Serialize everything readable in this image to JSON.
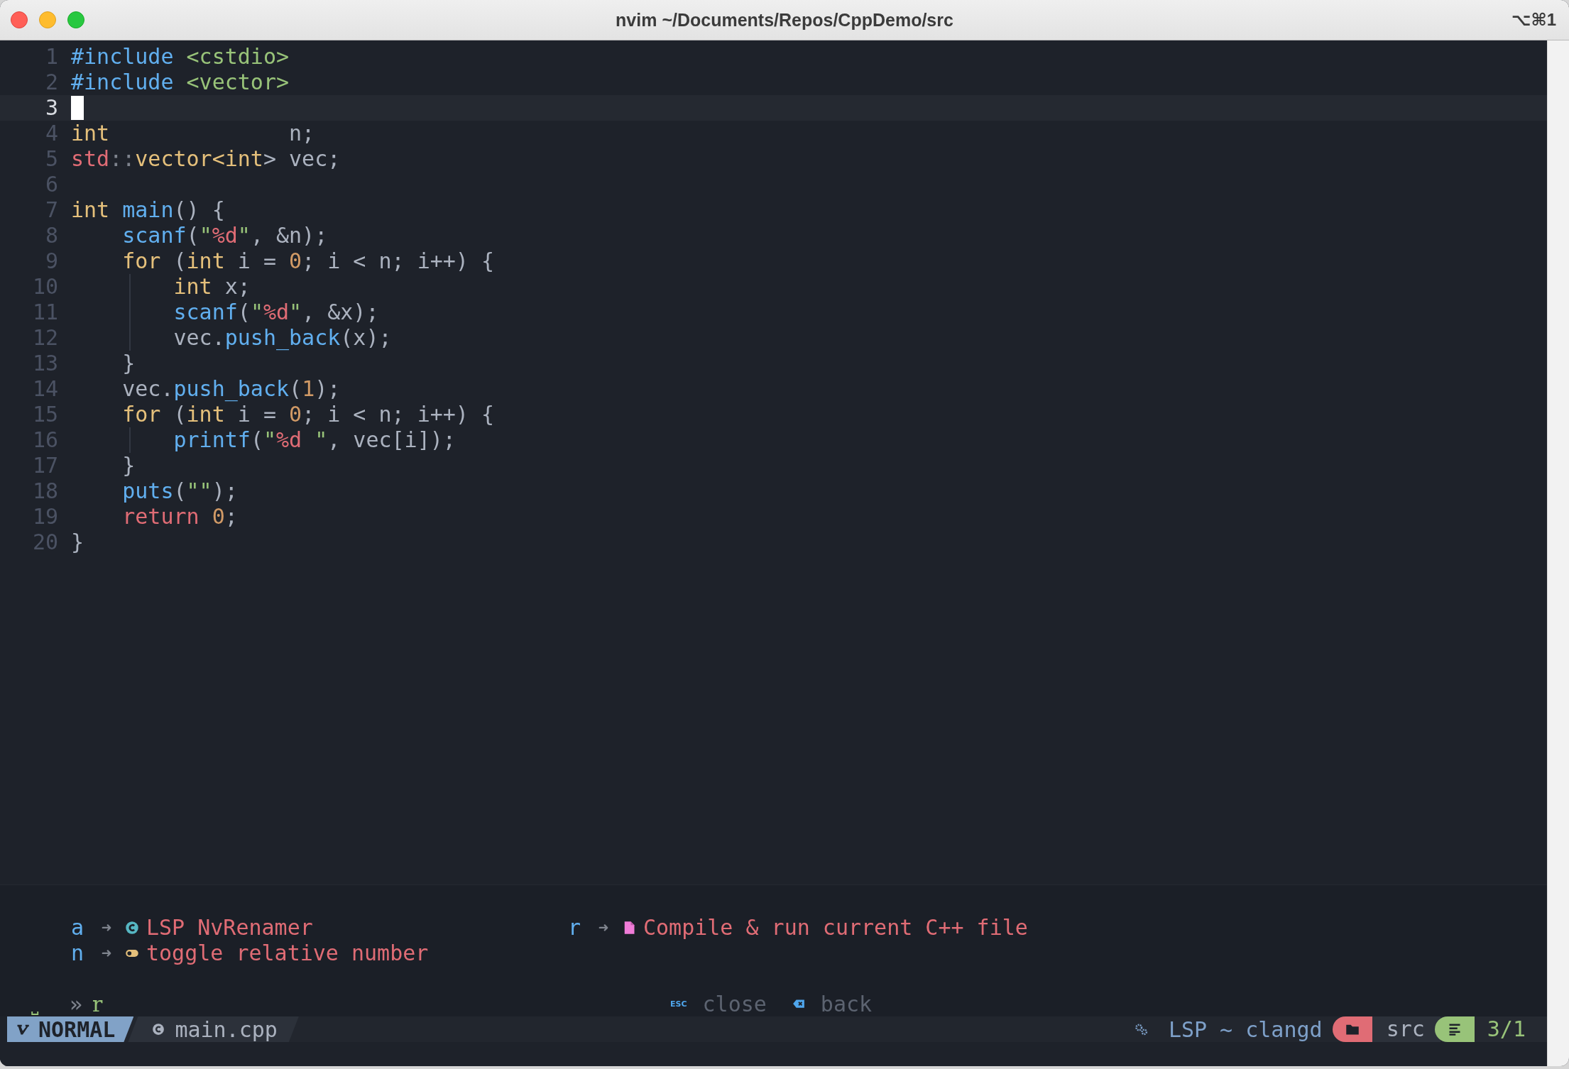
{
  "window": {
    "title": "nvim ~/Documents/Repos/CppDemo/src",
    "shortcut": "⌥⌘1"
  },
  "editor": {
    "lines": [
      {
        "number": "1",
        "current": false,
        "indent_guide": false,
        "tokens": [
          {
            "text": "#include",
            "kind": "preproc"
          },
          {
            "text": " <cstdio>",
            "kind": "header"
          }
        ]
      },
      {
        "number": "2",
        "current": false,
        "indent_guide": false,
        "tokens": [
          {
            "text": "#include",
            "kind": "preproc"
          },
          {
            "text": " <vector>",
            "kind": "header"
          }
        ]
      },
      {
        "number": "3",
        "current": true,
        "indent_guide": false
      },
      {
        "number": "4",
        "current": false,
        "indent_guide": false,
        "tokens": [
          {
            "text": "int",
            "kind": "type"
          },
          {
            "text": "              n;",
            "kind": "plain"
          }
        ]
      },
      {
        "number": "5",
        "current": false,
        "indent_guide": false,
        "tokens": [
          {
            "text": "std",
            "kind": "namespace"
          },
          {
            "text": "::",
            "kind": "punct"
          },
          {
            "text": "vector<int",
            "kind": "type"
          },
          {
            "text": "> vec;",
            "kind": "plain"
          }
        ]
      },
      {
        "number": "6",
        "current": false,
        "indent_guide": false
      },
      {
        "number": "7",
        "current": false,
        "indent_guide": false,
        "tokens": [
          {
            "text": "int",
            "kind": "type"
          },
          {
            "text": " main",
            "kind": "function"
          },
          {
            "text": "() {",
            "kind": "plain"
          }
        ]
      },
      {
        "number": "8",
        "current": false,
        "indent_guide": false,
        "tokens": [
          {
            "text": "    scanf",
            "kind": "function"
          },
          {
            "text": "(",
            "kind": "plain"
          },
          {
            "text": "\"",
            "kind": "string"
          },
          {
            "text": "%d",
            "kind": "format"
          },
          {
            "text": "\"",
            "kind": "string"
          },
          {
            "text": ", &n);",
            "kind": "plain"
          }
        ]
      },
      {
        "number": "9",
        "current": false,
        "indent_guide": false,
        "tokens": [
          {
            "text": "    for",
            "kind": "loop"
          },
          {
            "text": " (",
            "kind": "plain"
          },
          {
            "text": "int",
            "kind": "type"
          },
          {
            "text": " i = ",
            "kind": "plain"
          },
          {
            "text": "0",
            "kind": "number"
          },
          {
            "text": "; i < n; i++) {",
            "kind": "plain"
          }
        ]
      },
      {
        "number": "10",
        "current": false,
        "indent_guide": true,
        "tokens": [
          {
            "text": "        int",
            "kind": "type"
          },
          {
            "text": " x;",
            "kind": "plain"
          }
        ]
      },
      {
        "number": "11",
        "current": false,
        "indent_guide": true,
        "tokens": [
          {
            "text": "        scanf",
            "kind": "function"
          },
          {
            "text": "(",
            "kind": "plain"
          },
          {
            "text": "\"",
            "kind": "string"
          },
          {
            "text": "%d",
            "kind": "format"
          },
          {
            "text": "\"",
            "kind": "string"
          },
          {
            "text": ", &x);",
            "kind": "plain"
          }
        ]
      },
      {
        "number": "12",
        "current": false,
        "indent_guide": true,
        "tokens": [
          {
            "text": "        vec.",
            "kind": "plain"
          },
          {
            "text": "push_back",
            "kind": "function"
          },
          {
            "text": "(x);",
            "kind": "plain"
          }
        ]
      },
      {
        "number": "13",
        "current": false,
        "indent_guide": false,
        "tokens": [
          {
            "text": "    }",
            "kind": "plain"
          }
        ]
      },
      {
        "number": "14",
        "current": false,
        "indent_guide": false,
        "tokens": [
          {
            "text": "    vec.",
            "kind": "plain"
          },
          {
            "text": "push_back",
            "kind": "function"
          },
          {
            "text": "(",
            "kind": "plain"
          },
          {
            "text": "1",
            "kind": "number"
          },
          {
            "text": ");",
            "kind": "plain"
          }
        ]
      },
      {
        "number": "15",
        "current": false,
        "indent_guide": false,
        "tokens": [
          {
            "text": "    for",
            "kind": "loop"
          },
          {
            "text": " (",
            "kind": "plain"
          },
          {
            "text": "int",
            "kind": "type"
          },
          {
            "text": " i = ",
            "kind": "plain"
          },
          {
            "text": "0",
            "kind": "number"
          },
          {
            "text": "; i < n; i++) {",
            "kind": "plain"
          }
        ]
      },
      {
        "number": "16",
        "current": false,
        "indent_guide": true,
        "tokens": [
          {
            "text": "        printf",
            "kind": "function"
          },
          {
            "text": "(",
            "kind": "plain"
          },
          {
            "text": "\"",
            "kind": "string"
          },
          {
            "text": "%d",
            "kind": "format"
          },
          {
            "text": " \"",
            "kind": "string"
          },
          {
            "text": ", vec[i]);",
            "kind": "plain"
          }
        ]
      },
      {
        "number": "17",
        "current": false,
        "indent_guide": false,
        "tokens": [
          {
            "text": "    }",
            "kind": "plain"
          }
        ]
      },
      {
        "number": "18",
        "current": false,
        "indent_guide": false,
        "tokens": [
          {
            "text": "    puts",
            "kind": "function"
          },
          {
            "text": "(",
            "kind": "plain"
          },
          {
            "text": "\"\"",
            "kind": "string"
          },
          {
            "text": ");",
            "kind": "plain"
          }
        ]
      },
      {
        "number": "19",
        "current": false,
        "indent_guide": false,
        "tokens": [
          {
            "text": "    return",
            "kind": "return"
          },
          {
            "text": " 0",
            "kind": "number"
          },
          {
            "text": ";",
            "kind": "plain"
          }
        ]
      },
      {
        "number": "20",
        "current": false,
        "indent_guide": false,
        "tokens": [
          {
            "text": "}",
            "kind": "plain"
          }
        ]
      }
    ]
  },
  "which_key": {
    "columns": [
      [
        {
          "key": "a",
          "arrow": "➜",
          "kind": "lsp",
          "label": "LSP NvRenamer"
        },
        {
          "key": "n",
          "arrow": "➜",
          "kind": "toggle",
          "label": "toggle relative number"
        }
      ],
      [
        {
          "key": "r",
          "arrow": "➜",
          "kind": "file",
          "label": "Compile & run current C++ file"
        }
      ]
    ],
    "prompt": {
      "leader": "⎵",
      "separator": "»",
      "keys": "r"
    },
    "hints": [
      {
        "kind": "key",
        "key": "ESC",
        "label": "close"
      },
      {
        "kind": "backspace",
        "label": "back"
      }
    ]
  },
  "statusline": {
    "mode": "NORMAL",
    "file": "main.cpp",
    "lsp": "LSP ~ clangd",
    "directory": "src",
    "position": "3/1"
  }
}
